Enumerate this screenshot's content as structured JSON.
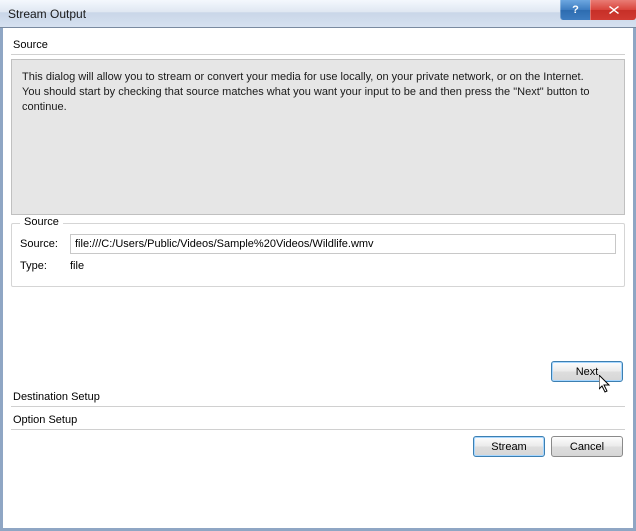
{
  "window": {
    "title": "Stream Output"
  },
  "source": {
    "header": "Source",
    "info_text": "This dialog will allow you to stream or convert your media for use locally, on your private network, or on the Internet.\nYou should start by checking that source matches what you want your input to be and then press the \"Next\" button to continue.",
    "group_title": "Source",
    "source_label": "Source:",
    "source_value": "file:///C:/Users/Public/Videos/Sample%20Videos/Wildlife.wmv",
    "type_label": "Type:",
    "type_value": "file"
  },
  "buttons": {
    "next": "Next",
    "stream": "Stream",
    "cancel": "Cancel"
  },
  "sections": {
    "destination": "Destination Setup",
    "options": "Option Setup"
  }
}
